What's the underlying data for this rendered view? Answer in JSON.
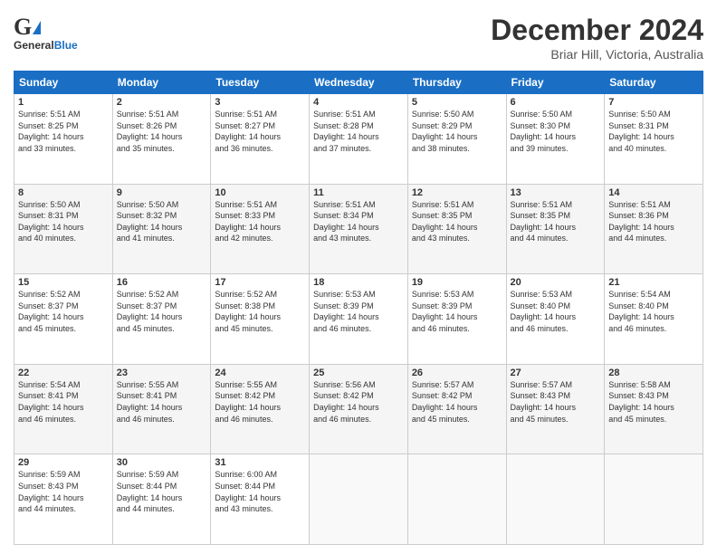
{
  "header": {
    "logo_general": "General",
    "logo_blue": "Blue",
    "title": "December 2024",
    "subtitle": "Briar Hill, Victoria, Australia"
  },
  "calendar": {
    "days_of_week": [
      "Sunday",
      "Monday",
      "Tuesday",
      "Wednesday",
      "Thursday",
      "Friday",
      "Saturday"
    ],
    "weeks": [
      [
        {
          "day": "1",
          "info": "Sunrise: 5:51 AM\nSunset: 8:25 PM\nDaylight: 14 hours\nand 33 minutes."
        },
        {
          "day": "2",
          "info": "Sunrise: 5:51 AM\nSunset: 8:26 PM\nDaylight: 14 hours\nand 35 minutes."
        },
        {
          "day": "3",
          "info": "Sunrise: 5:51 AM\nSunset: 8:27 PM\nDaylight: 14 hours\nand 36 minutes."
        },
        {
          "day": "4",
          "info": "Sunrise: 5:51 AM\nSunset: 8:28 PM\nDaylight: 14 hours\nand 37 minutes."
        },
        {
          "day": "5",
          "info": "Sunrise: 5:50 AM\nSunset: 8:29 PM\nDaylight: 14 hours\nand 38 minutes."
        },
        {
          "day": "6",
          "info": "Sunrise: 5:50 AM\nSunset: 8:30 PM\nDaylight: 14 hours\nand 39 minutes."
        },
        {
          "day": "7",
          "info": "Sunrise: 5:50 AM\nSunset: 8:31 PM\nDaylight: 14 hours\nand 40 minutes."
        }
      ],
      [
        {
          "day": "8",
          "info": "Sunrise: 5:50 AM\nSunset: 8:31 PM\nDaylight: 14 hours\nand 40 minutes."
        },
        {
          "day": "9",
          "info": "Sunrise: 5:50 AM\nSunset: 8:32 PM\nDaylight: 14 hours\nand 41 minutes."
        },
        {
          "day": "10",
          "info": "Sunrise: 5:51 AM\nSunset: 8:33 PM\nDaylight: 14 hours\nand 42 minutes."
        },
        {
          "day": "11",
          "info": "Sunrise: 5:51 AM\nSunset: 8:34 PM\nDaylight: 14 hours\nand 43 minutes."
        },
        {
          "day": "12",
          "info": "Sunrise: 5:51 AM\nSunset: 8:35 PM\nDaylight: 14 hours\nand 43 minutes."
        },
        {
          "day": "13",
          "info": "Sunrise: 5:51 AM\nSunset: 8:35 PM\nDaylight: 14 hours\nand 44 minutes."
        },
        {
          "day": "14",
          "info": "Sunrise: 5:51 AM\nSunset: 8:36 PM\nDaylight: 14 hours\nand 44 minutes."
        }
      ],
      [
        {
          "day": "15",
          "info": "Sunrise: 5:52 AM\nSunset: 8:37 PM\nDaylight: 14 hours\nand 45 minutes."
        },
        {
          "day": "16",
          "info": "Sunrise: 5:52 AM\nSunset: 8:37 PM\nDaylight: 14 hours\nand 45 minutes."
        },
        {
          "day": "17",
          "info": "Sunrise: 5:52 AM\nSunset: 8:38 PM\nDaylight: 14 hours\nand 45 minutes."
        },
        {
          "day": "18",
          "info": "Sunrise: 5:53 AM\nSunset: 8:39 PM\nDaylight: 14 hours\nand 46 minutes."
        },
        {
          "day": "19",
          "info": "Sunrise: 5:53 AM\nSunset: 8:39 PM\nDaylight: 14 hours\nand 46 minutes."
        },
        {
          "day": "20",
          "info": "Sunrise: 5:53 AM\nSunset: 8:40 PM\nDaylight: 14 hours\nand 46 minutes."
        },
        {
          "day": "21",
          "info": "Sunrise: 5:54 AM\nSunset: 8:40 PM\nDaylight: 14 hours\nand 46 minutes."
        }
      ],
      [
        {
          "day": "22",
          "info": "Sunrise: 5:54 AM\nSunset: 8:41 PM\nDaylight: 14 hours\nand 46 minutes."
        },
        {
          "day": "23",
          "info": "Sunrise: 5:55 AM\nSunset: 8:41 PM\nDaylight: 14 hours\nand 46 minutes."
        },
        {
          "day": "24",
          "info": "Sunrise: 5:55 AM\nSunset: 8:42 PM\nDaylight: 14 hours\nand 46 minutes."
        },
        {
          "day": "25",
          "info": "Sunrise: 5:56 AM\nSunset: 8:42 PM\nDaylight: 14 hours\nand 46 minutes."
        },
        {
          "day": "26",
          "info": "Sunrise: 5:57 AM\nSunset: 8:42 PM\nDaylight: 14 hours\nand 45 minutes."
        },
        {
          "day": "27",
          "info": "Sunrise: 5:57 AM\nSunset: 8:43 PM\nDaylight: 14 hours\nand 45 minutes."
        },
        {
          "day": "28",
          "info": "Sunrise: 5:58 AM\nSunset: 8:43 PM\nDaylight: 14 hours\nand 45 minutes."
        }
      ],
      [
        {
          "day": "29",
          "info": "Sunrise: 5:59 AM\nSunset: 8:43 PM\nDaylight: 14 hours\nand 44 minutes."
        },
        {
          "day": "30",
          "info": "Sunrise: 5:59 AM\nSunset: 8:44 PM\nDaylight: 14 hours\nand 44 minutes."
        },
        {
          "day": "31",
          "info": "Sunrise: 6:00 AM\nSunset: 8:44 PM\nDaylight: 14 hours\nand 43 minutes."
        },
        {
          "day": "",
          "info": ""
        },
        {
          "day": "",
          "info": ""
        },
        {
          "day": "",
          "info": ""
        },
        {
          "day": "",
          "info": ""
        }
      ]
    ]
  }
}
